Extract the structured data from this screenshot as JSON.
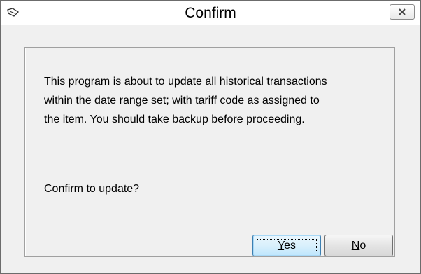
{
  "window": {
    "title": "Confirm"
  },
  "dialog": {
    "message_lines": [
      "This program is about to update all historical transactions",
      "within the date range set; with tariff code as assigned to",
      "the item. You should take backup before proceeding."
    ],
    "question": "Confirm to update?"
  },
  "buttons": {
    "yes": {
      "mnemonic": "Y",
      "rest": "es",
      "focused": true
    },
    "no": {
      "mnemonic": "N",
      "rest": "o"
    }
  },
  "icons": {
    "app": "app-icon",
    "close": "close-icon"
  },
  "colors": {
    "focused_button_border": "#3c7fb1",
    "focused_button_fill": "#d9f0fc"
  }
}
